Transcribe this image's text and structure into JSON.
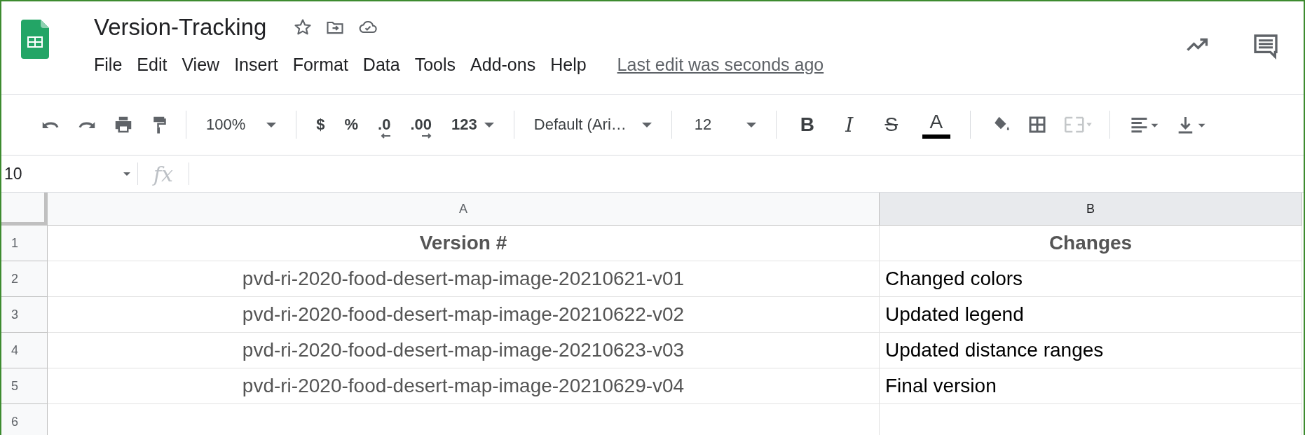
{
  "document": {
    "title": "Version-Tracking",
    "last_edit": "Last edit was seconds ago"
  },
  "menu": [
    "File",
    "Edit",
    "View",
    "Insert",
    "Format",
    "Data",
    "Tools",
    "Add-ons",
    "Help"
  ],
  "toolbar": {
    "zoom": "100%",
    "currency": "$",
    "percent": "%",
    "decrease_decimals": ".0",
    "increase_decimals": ".00",
    "number_format": "123",
    "font": "Default (Ari…",
    "font_size": "12",
    "bold": "B",
    "italic": "I",
    "strikethrough": "S",
    "text_color": "A"
  },
  "formula_bar": {
    "cell_reference": "10",
    "function_label": "fx"
  },
  "sheet": {
    "columns": [
      {
        "label": "A",
        "selected": false
      },
      {
        "label": "B",
        "selected": true
      }
    ],
    "rows": [
      {
        "number": "1",
        "cells": [
          "Version #",
          "Changes"
        ],
        "kind": "header"
      },
      {
        "number": "2",
        "cells": [
          "pvd-ri-2020-food-desert-map-image-20210621-v01",
          "Changed colors"
        ],
        "kind": "data"
      },
      {
        "number": "3",
        "cells": [
          "pvd-ri-2020-food-desert-map-image-20210622-v02",
          "Updated legend"
        ],
        "kind": "data"
      },
      {
        "number": "4",
        "cells": [
          "pvd-ri-2020-food-desert-map-image-20210623-v03",
          "Updated distance ranges"
        ],
        "kind": "data"
      },
      {
        "number": "5",
        "cells": [
          "pvd-ri-2020-food-desert-map-image-20210629-v04",
          "Final version"
        ],
        "kind": "data"
      },
      {
        "number": "6",
        "cells": [
          "",
          ""
        ],
        "kind": "data"
      }
    ]
  }
}
